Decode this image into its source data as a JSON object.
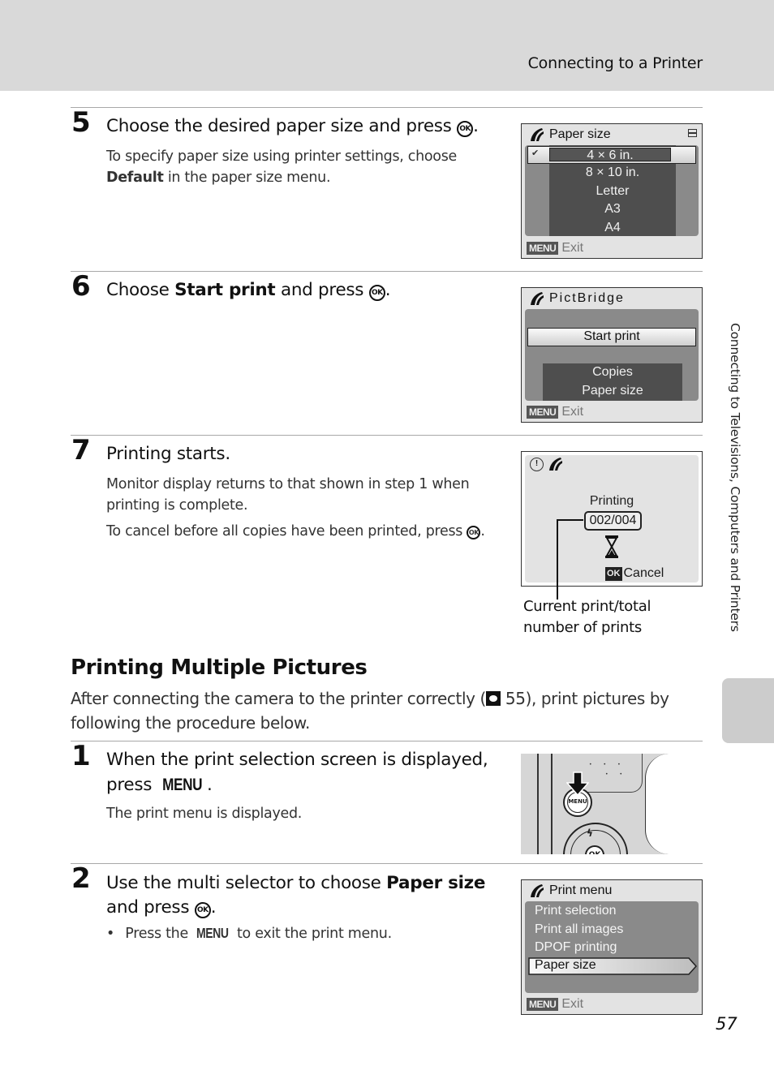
{
  "header": {
    "title": "Connecting to a Printer"
  },
  "side_tab": {
    "label": "Connecting to Televisions, Computers and Printers"
  },
  "steps_top": [
    {
      "number": "5",
      "heading": "Choose the desired paper size and press",
      "heading_icon": "ok-button-icon",
      "body_pre": "To specify paper size using printer settings, choose",
      "body_bold": "Default",
      "body_post": "in the paper size menu.",
      "screen": {
        "title": "Paper size",
        "selected": "4 × 6 in.",
        "items": [
          "4 × 6 in.",
          "8 × 10 in.",
          "Letter",
          "A3",
          "A4"
        ],
        "footer_badge": "MENU",
        "footer_label": "Exit"
      }
    },
    {
      "number": "6",
      "heading_pre": "Choose",
      "heading_bold": "Start print",
      "heading_post": "and press",
      "heading_icon": "ok-button-icon",
      "screen": {
        "title": "PictBridge",
        "selected": "Start print",
        "items": [
          "Copies",
          "Paper size"
        ],
        "footer_badge": "MENU",
        "footer_label": "Exit"
      }
    },
    {
      "number": "7",
      "heading": "Printing starts.",
      "body_1": "Monitor display returns to that shown in step 1 when printing is complete.",
      "body_2": "To cancel before all copies have been printed, press",
      "screen": {
        "status": "Printing",
        "counter": "002/004",
        "cancel_badge": "OK",
        "cancel_label": "Cancel"
      },
      "callout": "Current print/total number of prints"
    }
  ],
  "section": {
    "title": "Printing Multiple Pictures",
    "intro_pre": "After connecting the camera to the printer correctly (",
    "intro_ref": "55",
    "intro_post": "), print pictures by following the procedure below."
  },
  "steps_bottom": [
    {
      "number": "1",
      "heading": "When the print selection screen is displayed, press",
      "heading_key": "MENU",
      "body": "The print menu is displayed.",
      "illustration": {
        "button_label": "MENU",
        "ok_label": "OK"
      }
    },
    {
      "number": "2",
      "heading_pre": "Use the multi selector to choose",
      "heading_bold": "Paper size",
      "heading_post": "and press",
      "bullet_pre": "Press the",
      "bullet_key": "MENU",
      "bullet_post": "to exit the print menu.",
      "screen": {
        "title": "Print menu",
        "items": [
          "Print selection",
          "Print all images",
          "DPOF printing",
          "Paper size"
        ],
        "selected": "Paper size",
        "footer_badge": "MENU",
        "footer_label": "Exit"
      }
    }
  ],
  "page_number": "57",
  "icons": {
    "ok": "OK"
  }
}
